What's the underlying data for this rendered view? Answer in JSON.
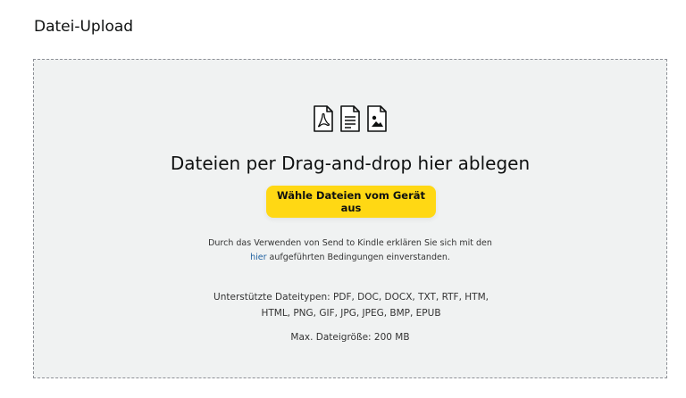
{
  "section": {
    "title": "Datei-Upload"
  },
  "dropzone": {
    "icons": [
      "pdf-file-icon",
      "document-file-icon",
      "image-file-icon"
    ],
    "heading": "Dateien per Drag-and-drop hier ablegen",
    "choose_button_label": "Wähle Dateien vom Gerät aus",
    "terms": {
      "line1": "Durch das Verwenden von Send to Kindle erklären Sie sich mit den",
      "link_text": "hier",
      "line2_rest": " aufgeführten Bedingungen einverstanden."
    },
    "supported_types": "Unterstützte Dateitypen: PDF, DOC, DOCX, TXT, RTF, HTM, HTML, PNG, GIF, JPG, JPEG, BMP, EPUB",
    "max_size": "Max. Dateigröße: 200 MB"
  },
  "colors": {
    "button_bg": "#ffd814",
    "link": "#2162a1",
    "dropzone_bg": "#f0f2f2",
    "dropzone_border": "#8d9096"
  }
}
